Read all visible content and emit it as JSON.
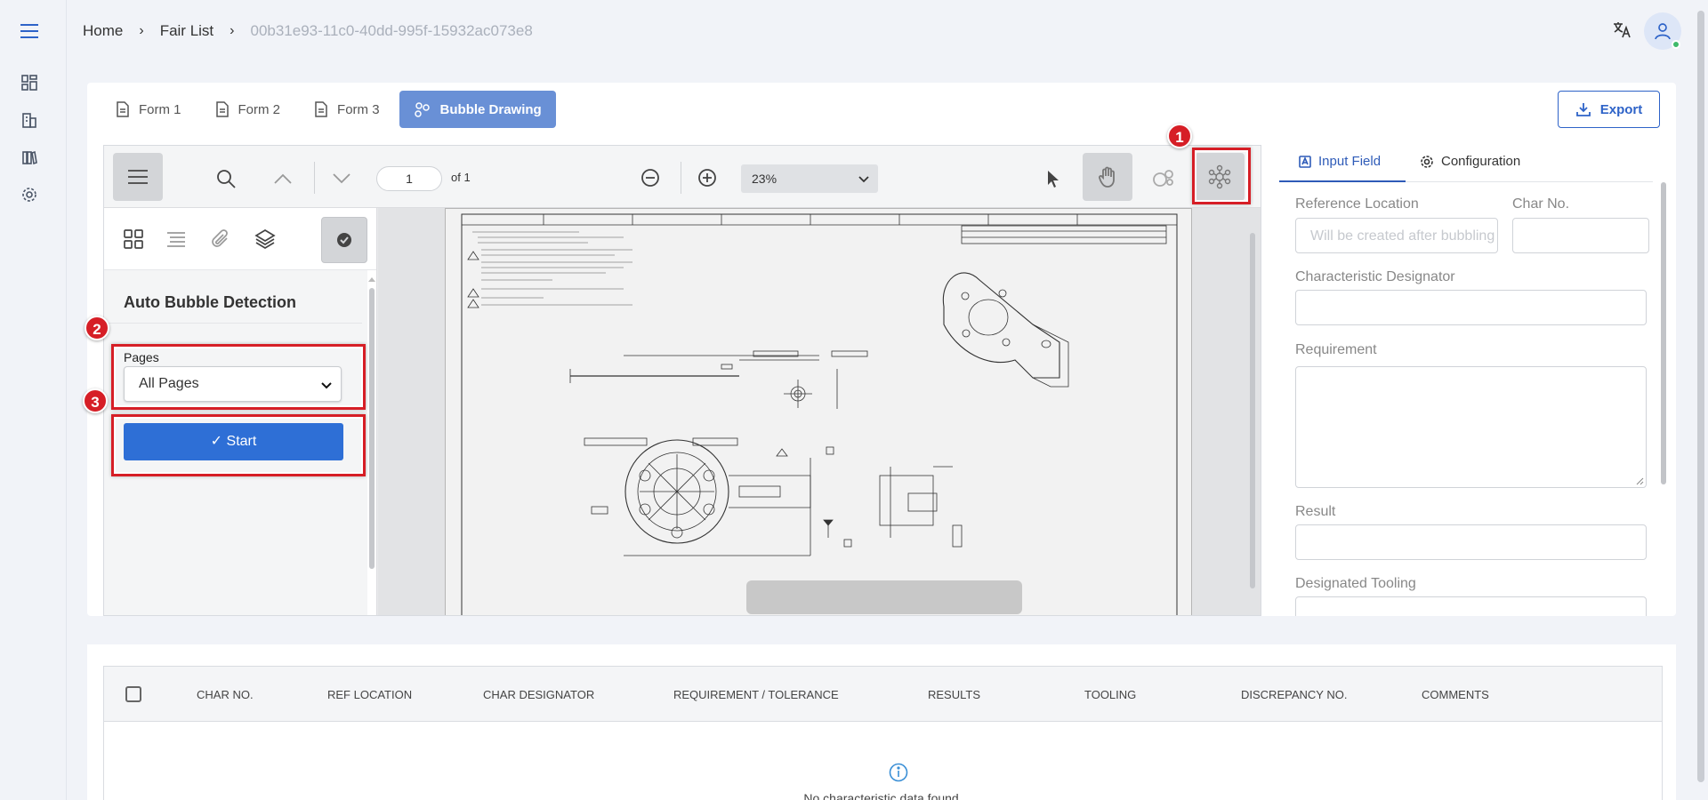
{
  "breadcrumb": {
    "home": "Home",
    "fair_list": "Fair List",
    "current_id": "00b31e93-11c0-40dd-995f-15932ac073e8"
  },
  "tabs": [
    {
      "label": "Form 1",
      "icon": "document-icon"
    },
    {
      "label": "Form 2",
      "icon": "document-icon"
    },
    {
      "label": "Form 3",
      "icon": "document-icon"
    },
    {
      "label": "Bubble Drawing",
      "icon": "bubbles-icon",
      "active": true
    }
  ],
  "export_label": "Export",
  "viewer": {
    "page_number": "1",
    "page_of": "of 1",
    "zoom": "23%"
  },
  "sidebar": {
    "title": "Auto Bubble Detection",
    "pages_label": "Pages",
    "pages_value": "All Pages",
    "start_label": "✓ Start"
  },
  "annotations": [
    "1",
    "2",
    "3"
  ],
  "right_panel": {
    "tabs": [
      {
        "label": "Input Field",
        "active": true
      },
      {
        "label": "Configuration"
      }
    ],
    "fields": {
      "reference_location": "Reference Location",
      "reference_placeholder": "Will be created after bubbling",
      "char_no": "Char No.",
      "characteristic_designator": "Characteristic Designator",
      "requirement": "Requirement",
      "result": "Result",
      "designated_tooling": "Designated Tooling"
    }
  },
  "table": {
    "columns": [
      "CHAR NO.",
      "REF LOCATION",
      "CHAR DESIGNATOR",
      "REQUIREMENT / TOLERANCE",
      "RESULTS",
      "TOOLING",
      "DISCREPANCY NO.",
      "COMMENTS"
    ],
    "empty_message": "No characteristic data found."
  },
  "colors": {
    "accent": "#2e6fd6",
    "active_tab": "#6990d6",
    "annotation": "#d61e26"
  }
}
